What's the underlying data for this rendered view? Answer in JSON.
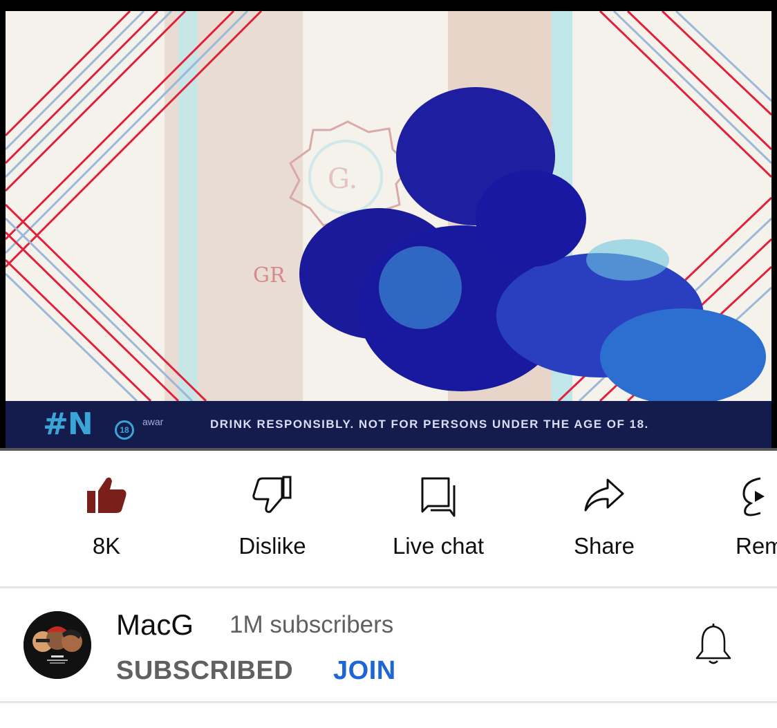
{
  "video": {
    "banner_hashtag": "#N",
    "banner_badge": "18",
    "banner_aware": "awar",
    "banner_text": "DRINK RESPONSIBLY. NOT FOR PERSONS UNDER THE AGE OF 18."
  },
  "actions": [
    {
      "label": "8K",
      "icon": "thumbs-up-filled-icon",
      "color": "#7a1f1a"
    },
    {
      "label": "Dislike",
      "icon": "thumbs-down-icon"
    },
    {
      "label": "Live chat",
      "icon": "chat-icon"
    },
    {
      "label": "Share",
      "icon": "share-arrow-icon"
    },
    {
      "label": "Rem",
      "icon": "remix-icon"
    }
  ],
  "channel": {
    "name": "MacG",
    "subscribers": "1M subscribers",
    "subscribed_label": "SUBSCRIBED",
    "join_label": "JOIN",
    "join_color": "#1f65d6",
    "bell_icon": "bell-icon"
  }
}
